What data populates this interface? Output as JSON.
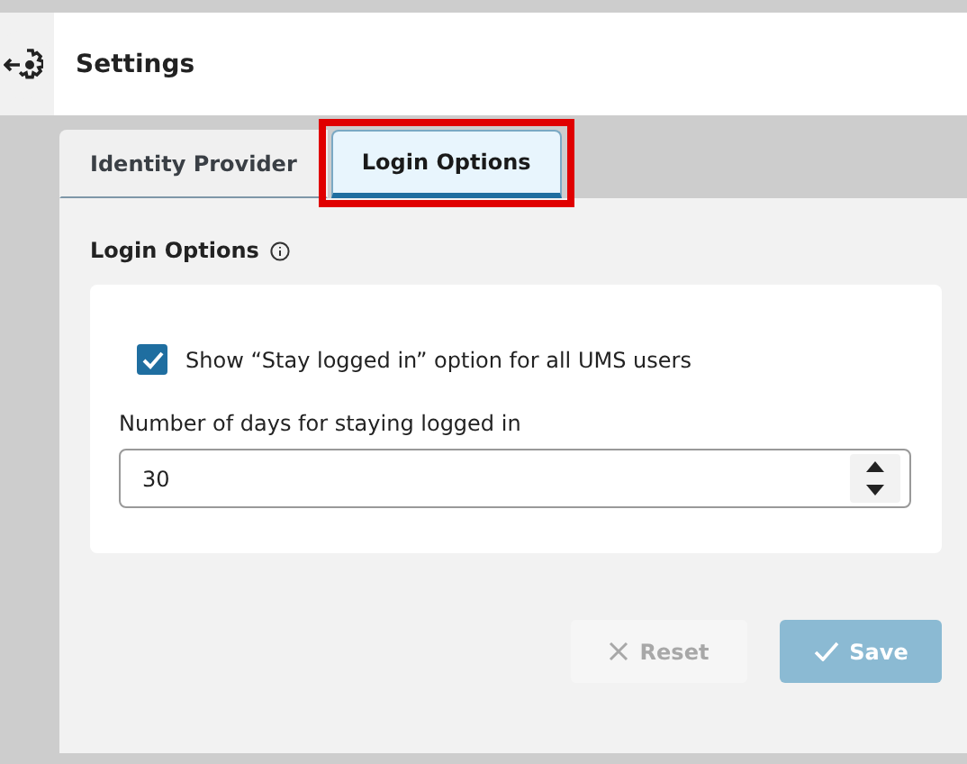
{
  "header": {
    "title": "Settings"
  },
  "tabs": [
    {
      "label": "Identity Provider",
      "selected": false,
      "highlighted": false
    },
    {
      "label": "Login Options",
      "selected": true,
      "highlighted": true
    }
  ],
  "section": {
    "title": "Login Options",
    "option": {
      "label": "Show “Stay logged in” option for all UMS users",
      "checked": true
    },
    "days": {
      "label": "Number of days for staying logged in",
      "value": "30"
    }
  },
  "buttons": [
    {
      "kind": "reset",
      "label": "Reset",
      "disabled": true
    },
    {
      "kind": "save",
      "label": "Save",
      "disabled": true
    }
  ]
}
